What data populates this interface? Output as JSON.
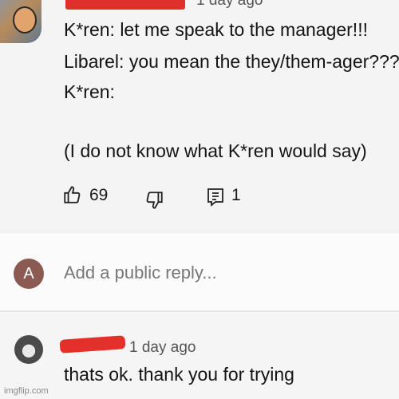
{
  "comment": {
    "timestamp": "1 day ago",
    "lines": [
      "K*ren: let me speak to the manager!!!",
      "Libarel: you mean the they/them-ager???",
      "K*ren:",
      "(I do not know what K*ren would say)"
    ],
    "likes": "69",
    "replies": "1"
  },
  "reply_box": {
    "avatar_letter": "A",
    "placeholder": "Add a public reply..."
  },
  "reply": {
    "timestamp": "1 day ago",
    "text": "thats ok. thank you for trying"
  },
  "watermark": "imgflip.com",
  "colors": {
    "redaction": "#e0302b",
    "reply_avatar": "#8b5b53"
  },
  "icons": [
    "thumbs-up-icon",
    "thumbs-down-icon",
    "reply-comment-icon"
  ]
}
